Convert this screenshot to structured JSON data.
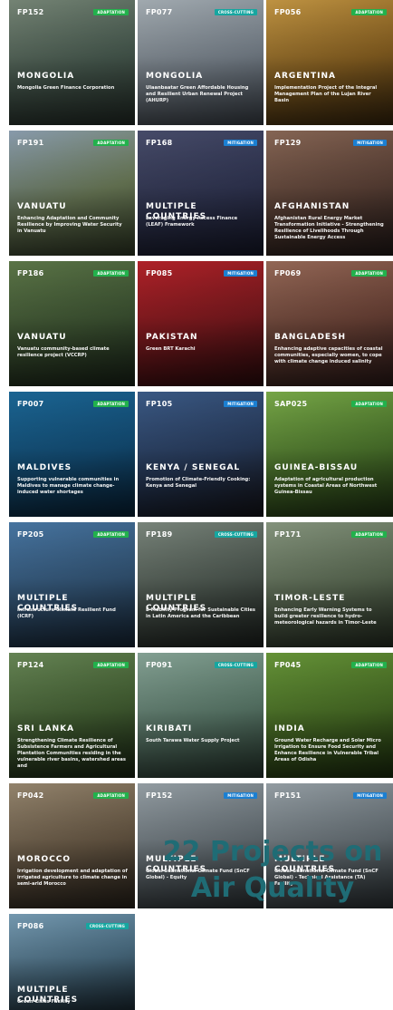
{
  "cards": [
    {
      "code": "FP152",
      "badge": "ADAPTATION",
      "type": "adaptation",
      "country": "MONGOLIA",
      "title": "Mongolia Green Finance Corporation",
      "colors": [
        "#7a8a7a",
        "#4a5d52",
        "#2e3a33"
      ]
    },
    {
      "code": "FP077",
      "badge": "CROSS-CUTTING",
      "type": "crosscutting",
      "country": "MONGOLIA",
      "title": "Ulaanbaatar Green Affordable Housing and Resilient Urban Renewal Project (AHURP)",
      "colors": [
        "#a9b2b8",
        "#7c8690",
        "#4e5660"
      ]
    },
    {
      "code": "FP056",
      "badge": "ADAPTATION",
      "type": "adaptation",
      "country": "ARGENTINA",
      "title": "Implementation Project of the Integral Management Plan of the Lujan River Basin",
      "colors": [
        "#c89a45",
        "#8c6322",
        "#4a3211"
      ]
    },
    {
      "code": "FP191",
      "badge": "ADAPTATION",
      "type": "adaptation",
      "country": "VANUATU",
      "title": "Enhancing Adaptation and Community Resilience by Improving Water Security in Vanuatu",
      "colors": [
        "#8fa2b4",
        "#6f7f5b",
        "#3e4a30"
      ]
    },
    {
      "code": "FP168",
      "badge": "MITIGATION",
      "type": "mitigation",
      "country": "MULTIPLE COUNTRIES",
      "title": "Leveraging Energy Access Finance (LEAF) Framework",
      "colors": [
        "#4a4f6e",
        "#323755",
        "#1d2037"
      ]
    },
    {
      "code": "FP129",
      "badge": "MITIGATION",
      "type": "mitigation",
      "country": "AFGHANISTAN",
      "title": "Afghanistan Rural Energy Market Transformation Initiative - Strengthening Resilience of Livelihoods Through Sustainable Energy Access",
      "colors": [
        "#8c6a58",
        "#5e4338",
        "#2e2220"
      ]
    },
    {
      "code": "FP186",
      "badge": "ADAPTATION",
      "type": "adaptation",
      "country": "VANUATU",
      "title": "Vanuatu community-based climate resilience project (VCCRP)",
      "colors": [
        "#5f7a4a",
        "#3f5634",
        "#223020"
      ]
    },
    {
      "code": "FP085",
      "badge": "MITIGATION",
      "type": "mitigation",
      "country": "PAKISTAN",
      "title": "Green BRT Karachi",
      "colors": [
        "#b8232a",
        "#7e1a1f",
        "#3a0e10"
      ]
    },
    {
      "code": "FP069",
      "badge": "ADAPTATION",
      "type": "adaptation",
      "country": "BANGLADESH",
      "title": "Enhancing adaptive capacities of coastal communities, especially women, to cope with climate change induced salinity",
      "colors": [
        "#9a6c5a",
        "#6e4438",
        "#3a2220"
      ]
    },
    {
      "code": "FP007",
      "badge": "ADAPTATION",
      "type": "adaptation",
      "country": "MALDIVES",
      "title": "Supporting vulnerable communities in Maldives to manage climate change-induced water shortages",
      "colors": [
        "#1c6a9a",
        "#14507a",
        "#0a2c48"
      ]
    },
    {
      "code": "FP105",
      "badge": "MITIGATION",
      "type": "mitigation",
      "country": "KENYA / SENEGAL",
      "title": "Promotion of Climate-Friendly Cooking: Kenya and Senegal",
      "colors": [
        "#3d5d8a",
        "#2a3e60",
        "#1a1a22"
      ]
    },
    {
      "code": "SAP025",
      "badge": "ADAPTATION",
      "type": "adaptation",
      "country": "GUINEA-BISSAU",
      "title": "Adaptation of agricultural production systems in Coastal Areas of Northwest Guinea-Bissau",
      "colors": [
        "#7cae4a",
        "#4f7a2e",
        "#2a4418"
      ]
    },
    {
      "code": "FP205",
      "badge": "ADAPTATION",
      "type": "adaptation",
      "country": "MULTIPLE COUNTRIES",
      "title": "Infrastructure Climate Resilient Fund (ICRF)",
      "colors": [
        "#4a7aa8",
        "#35587a",
        "#1f3348"
      ]
    },
    {
      "code": "FP189",
      "badge": "CROSS-CUTTING",
      "type": "crosscutting",
      "country": "MULTIPLE COUNTRIES",
      "title": "E-Mobility Program for Sustainable Cities in Latin America and the Caribbean",
      "colors": [
        "#7e8a80",
        "#4f5a52",
        "#262c28"
      ]
    },
    {
      "code": "FP171",
      "badge": "ADAPTATION",
      "type": "adaptation",
      "country": "TIMOR-LESTE",
      "title": "Enhancing Early Warning Systems to build greater resilience to hydro-meteorological hazards in Timor-Leste",
      "colors": [
        "#8a9a82",
        "#5e6e56",
        "#333e2e"
      ]
    },
    {
      "code": "FP124",
      "badge": "ADAPTATION",
      "type": "adaptation",
      "country": "SRI LANKA",
      "title": "Strengthening Climate Resilience of Subsistence Farmers and Agricultural Plantation Communities residing in the vulnerable river basins, watershed areas and",
      "colors": [
        "#6a8a58",
        "#456234",
        "#22321a"
      ]
    },
    {
      "code": "FP091",
      "badge": "CROSS-CUTTING",
      "type": "crosscutting",
      "country": "KIRIBATI",
      "title": "South Tarawa Water Supply Project",
      "colors": [
        "#8aa89a",
        "#5e7e6e",
        "#344a3e"
      ]
    },
    {
      "code": "FP045",
      "badge": "ADAPTATION",
      "type": "adaptation",
      "country": "INDIA",
      "title": "Ground Water Recharge and Solar Micro Irrigation to Ensure Food Security and Enhance Resilience in Vulnerable Tribal Areas of Odisha",
      "colors": [
        "#6a9a3a",
        "#4a7026",
        "#263c12"
      ]
    },
    {
      "code": "FP042",
      "badge": "ADAPTATION",
      "type": "adaptation",
      "country": "MOROCCO",
      "title": "Irrigation development and adaptation of irrigated agriculture to climate change in semi-arid Morocco",
      "colors": [
        "#9a8a72",
        "#6a5a46",
        "#362e24"
      ]
    },
    {
      "code": "FP152",
      "badge": "MITIGATION",
      "type": "mitigation",
      "country": "MULTIPLE COUNTRIES",
      "title": "Global Subnational Climate Fund (SnCF Global) - Equity",
      "colors": [
        "#9aa4aa",
        "#6a747a",
        "#3a4246"
      ]
    },
    {
      "code": "FP151",
      "badge": "MITIGATION",
      "type": "mitigation",
      "country": "MULTIPLE COUNTRIES",
      "title": "Global Subnational Climate Fund (SnCF Global) - Technical Assistance (TA) Facility",
      "colors": [
        "#9aa4aa",
        "#6a747a",
        "#3a4246"
      ]
    },
    {
      "code": "FP086",
      "badge": "CROSS-CUTTING",
      "type": "crosscutting",
      "country": "MULTIPLE COUNTRIES",
      "title": "Green Cities Facility",
      "colors": [
        "#7aa0b8",
        "#4e7288",
        "#283e4c"
      ]
    }
  ],
  "headline": {
    "line1": "22 Projects on",
    "line2": "Air Quality"
  }
}
